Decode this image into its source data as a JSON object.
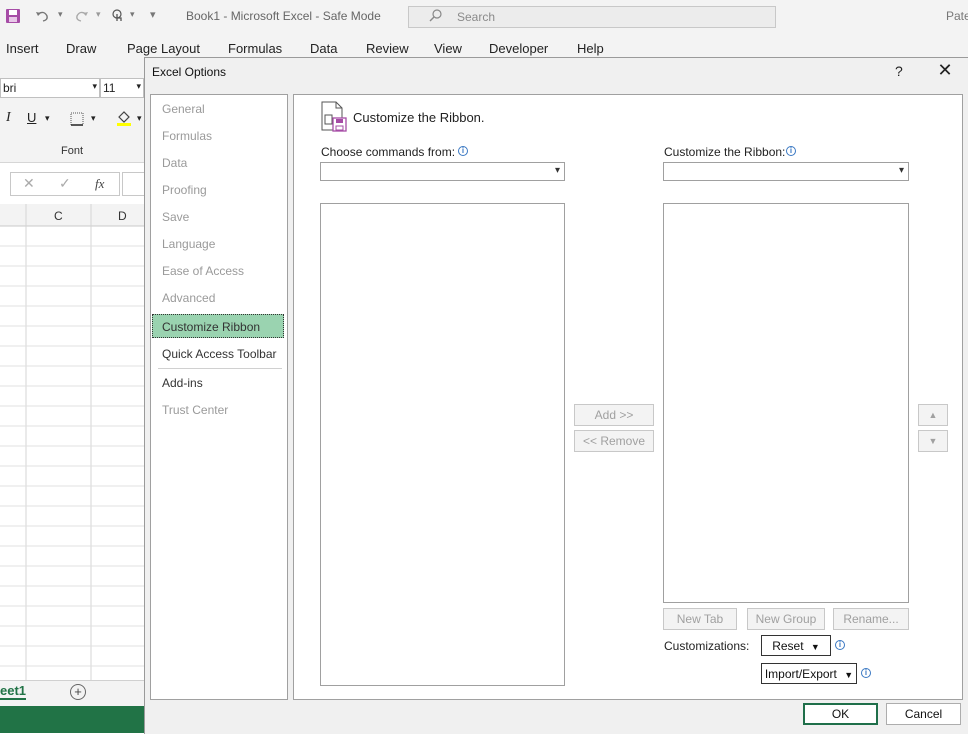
{
  "app": {
    "title": "Book1  -  Microsoft Excel  -  Safe Mode",
    "search_placeholder": "Search",
    "user_fragment": "Pate",
    "menu": [
      "Insert",
      "Draw",
      "Page Layout",
      "Formulas",
      "Data",
      "Review",
      "View",
      "Developer",
      "Help"
    ],
    "font_name": "bri",
    "font_size": "11",
    "font_group_label": "Font",
    "columns": [
      "C",
      "D"
    ],
    "sheet_tab": "eet1"
  },
  "dialog": {
    "title": "Excel Options",
    "help_label": "?",
    "close_label": "✕",
    "nav": [
      {
        "label": "General",
        "enabled": false
      },
      {
        "label": "Formulas",
        "enabled": false
      },
      {
        "label": "Data",
        "enabled": false
      },
      {
        "label": "Proofing",
        "enabled": false
      },
      {
        "label": "Save",
        "enabled": false
      },
      {
        "label": "Language",
        "enabled": false
      },
      {
        "label": "Ease of Access",
        "enabled": false
      },
      {
        "label": "Advanced",
        "enabled": false
      },
      {
        "label": "Customize Ribbon",
        "enabled": true
      },
      {
        "label": "Quick Access Toolbar",
        "enabled": true
      },
      {
        "label": "Add-ins",
        "enabled": true
      },
      {
        "label": "Trust Center",
        "enabled": false
      }
    ],
    "selected_nav": "Customize Ribbon",
    "header": "Customize the Ribbon.",
    "choose_commands_label": "Choose commands from:",
    "customize_ribbon_label": "Customize the Ribbon:",
    "choose_commands_value": "",
    "customize_ribbon_value": "",
    "add_button": "Add >>",
    "remove_button": "<< Remove",
    "move_up": "▲",
    "move_down": "▼",
    "new_tab_button": "New Tab",
    "new_group_button": "New Group",
    "rename_button": "Rename...",
    "customizations_label": "Customizations:",
    "reset_button": "Reset",
    "import_export_button": "Import/Export",
    "ok_button": "OK",
    "cancel_button": "Cancel",
    "info_glyph": "i",
    "dropdown_glyph": "▾"
  },
  "colors": {
    "selected_nav_bg": "#9ad3b0",
    "excel_green": "#217346",
    "info_blue": "#3a78c3"
  }
}
